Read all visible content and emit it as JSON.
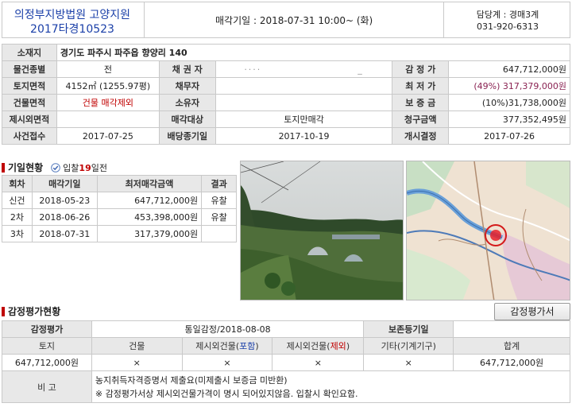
{
  "header": {
    "court": "의정부지방법원 고양지원",
    "case_no": "2017타경10523",
    "sale_date_label": "매각기일 : 2018-07-31   10:00~ (화)",
    "dept": "담당계 : 경매3계",
    "phone": "031-920-6313"
  },
  "property": {
    "address_label": "소재지",
    "address": "경기도 파주시 파주읍 향양리 140",
    "rows": {
      "type_label": "물건종별",
      "type": "전",
      "creditor_label": "채 권 자",
      "creditor": "",
      "appraisal_label": "감 정 가",
      "appraisal": "647,712,000원",
      "land_label": "토지면적",
      "land": "4152㎡ (1255.97평)",
      "debtor_label": "채무자",
      "debtor": "",
      "min_price_label": "최 저 가",
      "min_price": "(49%) 317,379,000원",
      "bldg_label": "건물면적",
      "bldg": "건물 매각제외",
      "owner_label": "소유자",
      "owner": "",
      "deposit_label": "보 증 금",
      "deposit": "(10%)31,738,000원",
      "excl_label": "제시외면적",
      "excl": "",
      "target_label": "매각대상",
      "target": "토지만매각",
      "claim_label": "청구금액",
      "claim": "377,352,495원",
      "reception_label": "사건접수",
      "reception": "2017-07-25",
      "dividend_label": "배당종기일",
      "dividend": "2017-10-19",
      "start_label": "개시결정",
      "start": "2017-07-26"
    }
  },
  "history": {
    "title": "기일현황",
    "prefix": "입찰",
    "days": "19",
    "suffix": "일전",
    "headers": [
      "회차",
      "매각기일",
      "최저매각금액",
      "결과"
    ],
    "rows": [
      [
        "신건",
        "2018-05-23",
        "647,712,000원",
        "유찰"
      ],
      [
        "2차",
        "2018-06-26",
        "453,398,000원",
        "유찰"
      ],
      [
        "3차",
        "2018-07-31",
        "317,379,000원",
        ""
      ]
    ]
  },
  "appraisal": {
    "title": "감정평가현황",
    "button": "감정평가서",
    "label": "감정평가",
    "value": "통일감정/2018-08-08",
    "reg_label": "보존등기일",
    "reg_value": "",
    "cols": {
      "land": "토지",
      "building": "건물",
      "extra_incl_pre": "제시외건물(",
      "extra_incl": "포함",
      "extra_excl_pre": "제시외건물(",
      "extra_excl": "제외",
      "close": ")",
      "etc": "기타(기계기구)",
      "total": "합계"
    },
    "values": [
      "647,712,000원",
      "×",
      "×",
      "×",
      "×",
      "647,712,000원"
    ],
    "note_label": "비 고",
    "note1": "농지취득자격증명서 제출요(미제출시 보증금 미반환)",
    "note2": "※ 감정평가서상 제시외건물가격이 명시 되어있지않음. 입찰시 확인요함."
  }
}
